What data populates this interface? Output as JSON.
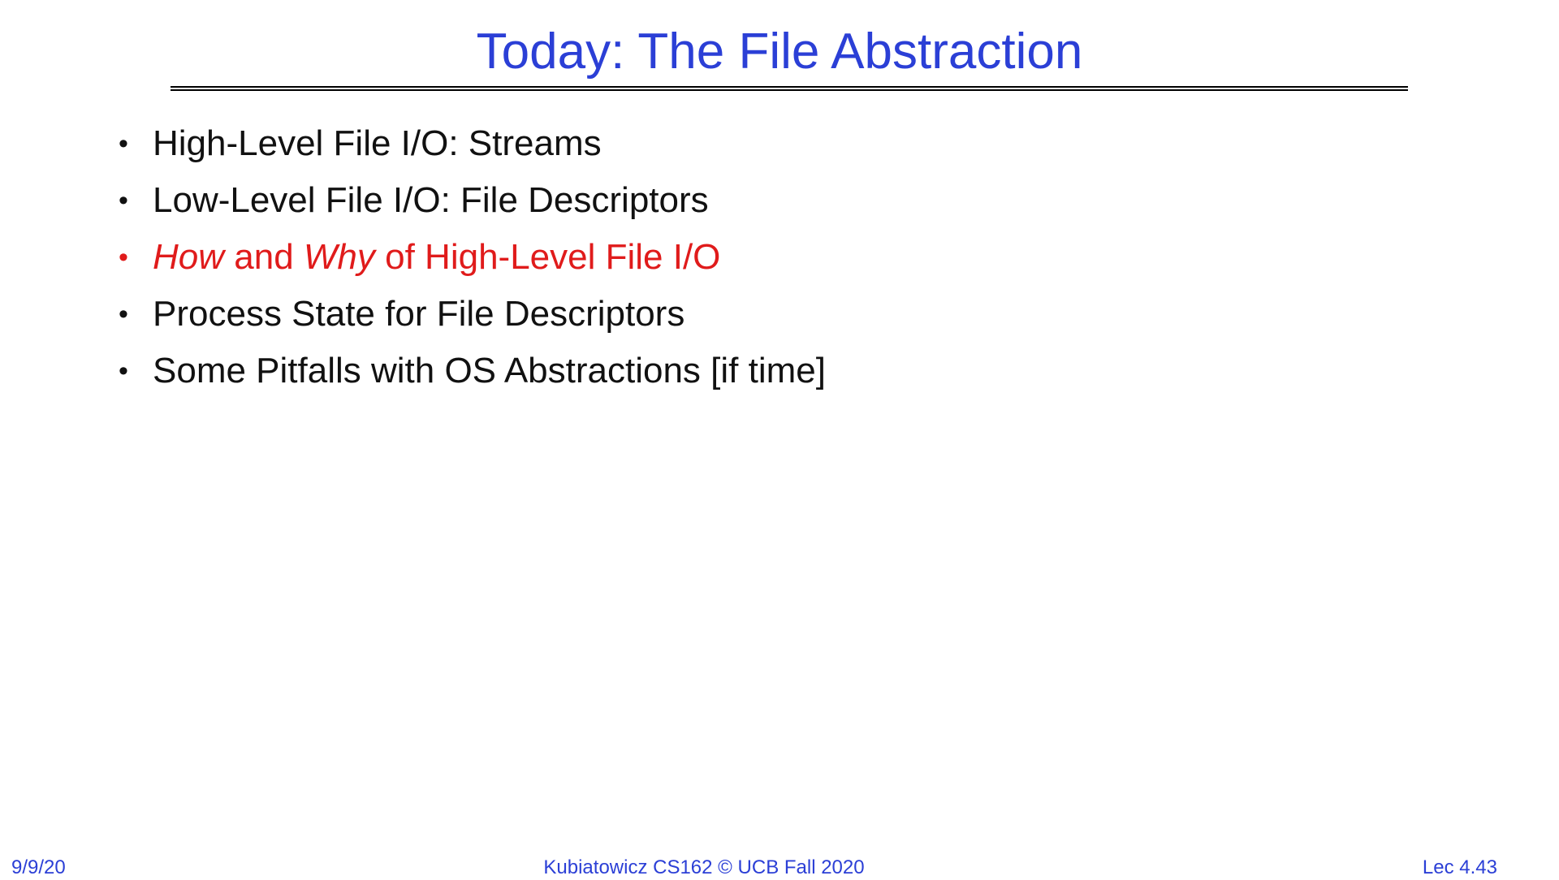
{
  "slide": {
    "title": "Today: The File Abstraction",
    "bullets": [
      {
        "text": "High-Level File I/O: Streams"
      },
      {
        "text": "Low-Level File I/O: File Descriptors"
      },
      {
        "emph1": "How",
        "mid": " and ",
        "emph2": "Why",
        "rest": " of High-Level File I/O"
      },
      {
        "text": "Process State for File Descriptors"
      },
      {
        "text": "Some Pitfalls with OS Abstractions [if time]"
      }
    ],
    "bullet_symbol": "•"
  },
  "footer": {
    "date": "9/9/20",
    "course": "Kubiatowicz CS162 © UCB Fall 2020",
    "lecture": "Lec 4.43"
  },
  "colors": {
    "title": "#2b3fd6",
    "highlight": "#e01b1b",
    "text": "#111111"
  }
}
